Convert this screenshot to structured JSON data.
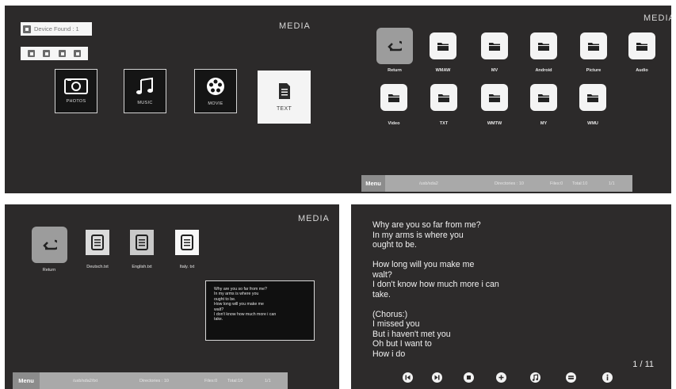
{
  "media_label": "MEDIA",
  "panel1": {
    "device_found": "Device Found : 1",
    "categories": [
      {
        "label": "PHOTOS",
        "icon": "camera-icon"
      },
      {
        "label": "MUSIC",
        "icon": "music-note-icon"
      },
      {
        "label": "MOVIE",
        "icon": "film-reel-icon"
      },
      {
        "label": "TEXT",
        "icon": "document-icon"
      }
    ]
  },
  "panel2": {
    "items": [
      {
        "label": "Return",
        "icon": "return-icon"
      },
      {
        "label": "WMAW",
        "icon": "folder-icon"
      },
      {
        "label": "MV",
        "icon": "folder-icon"
      },
      {
        "label": "Android",
        "icon": "folder-icon"
      },
      {
        "label": "Picture",
        "icon": "folder-icon"
      },
      {
        "label": "Audio",
        "icon": "folder-icon"
      },
      {
        "label": "Video",
        "icon": "folder-icon"
      },
      {
        "label": "TXT",
        "icon": "folder-icon"
      },
      {
        "label": "WMTW",
        "icon": "folder-icon"
      },
      {
        "label": "MY",
        "icon": "folder-icon"
      },
      {
        "label": "WMU",
        "icon": "folder-icon"
      }
    ],
    "statusbar": {
      "menu": "Menu",
      "path": "/usb/sda2",
      "directories": "Directories : 10",
      "files": "Files:0",
      "total": "Total:10",
      "page": "1/1"
    }
  },
  "panel3": {
    "return_label": "Return",
    "files": [
      "Deutsch.txt",
      "English.txt",
      "Italy. txt"
    ],
    "preview_lines": [
      "Why are you so far from me?",
      "In my arms is where you",
      "ought to be.",
      "How long will you make me",
      "walt?",
      "I don't know how much more i can",
      "take."
    ],
    "statusbar": {
      "menu": "Menu",
      "path": "/usb/sda2/txt",
      "directories": "Directories : 10",
      "files": "Files:0",
      "total": "Total:10",
      "page": "1/1"
    }
  },
  "panel4": {
    "lines": [
      "Why are you so far from me?",
      "In my arms is where you",
      "ought to be.",
      "",
      "How long will you make me",
      "walt?",
      "I don't know how much more i can",
      "take.",
      "",
      "(Chorus:)",
      "I missed you",
      "But i haven't met you",
      "Oh but I want to",
      "How i do"
    ],
    "page": "1 / 11",
    "controls": [
      "previous-icon",
      "next-icon",
      "stop-icon",
      "plus-icon",
      "music-icon",
      "playlist-icon",
      "info-icon"
    ]
  }
}
